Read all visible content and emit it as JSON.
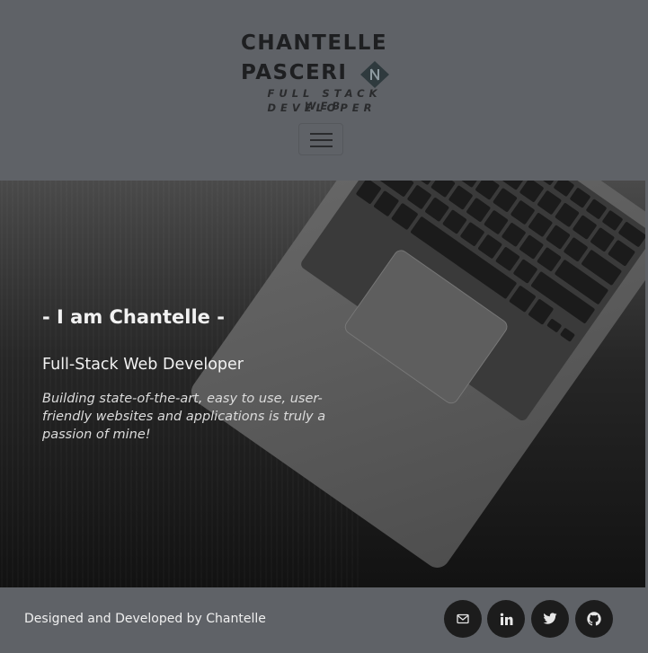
{
  "brand": {
    "name_line1": "CHANTELLE",
    "name_line2": "PASCERI",
    "tagline_line1": "FULL STACK WEB",
    "tagline_line2": "DEVELOPER"
  },
  "nav": {
    "toggler_icon": "hamburger-icon"
  },
  "hero": {
    "title": "- I am Chantelle -",
    "subtitle": "Full-Stack Web Developer",
    "text": "Building state-of-the-art, easy to use, user-friendly websites and applications is truly a passion of mine!",
    "background_image": "laptop-keyboard-photo"
  },
  "footer": {
    "credit": "Designed and Developed by Chantelle",
    "social": [
      {
        "icon": "mail-icon"
      },
      {
        "icon": "linkedin-icon"
      },
      {
        "icon": "twitter-icon"
      },
      {
        "icon": "github-icon"
      }
    ]
  },
  "colors": {
    "header_bg": "#5f6267",
    "hero_bg": "#171717",
    "footer_bg": "#5f6267",
    "social_bg": "#1c1c1c",
    "text_light": "#f2f2f2"
  }
}
